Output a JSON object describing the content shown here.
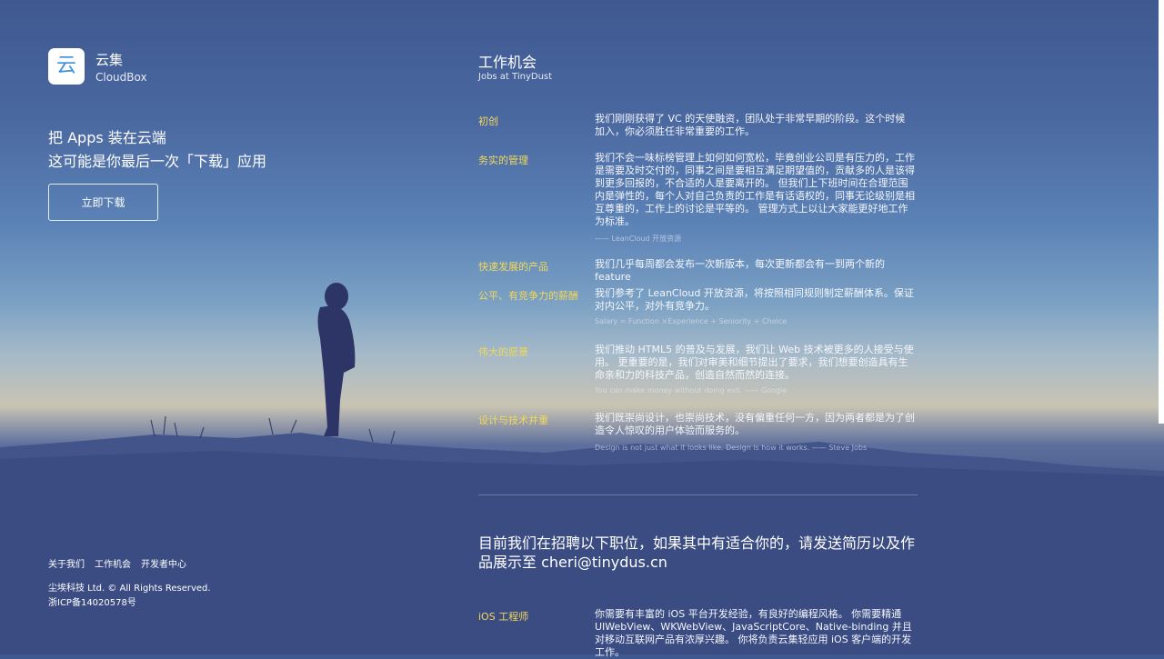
{
  "brand": {
    "logo_char": "云",
    "name_cn": "云集",
    "name_en": "CloudBox"
  },
  "hero": {
    "line1": "把 Apps 装在云端",
    "line2": "这可能是你最后一次「下载」应用",
    "download_button": "立即下载"
  },
  "footer": {
    "links": [
      "关于我们",
      "工作机会",
      "开发者中心"
    ],
    "copyright": "尘埃科技 Ltd. © All Rights Reserved.",
    "icp": "浙ICP备14020578号"
  },
  "jobs": {
    "title": "工作机会",
    "subtitle": "Jobs at TinyDust",
    "items": [
      {
        "label": "初创",
        "text": "我们刚刚获得了 VC 的天使融资，团队处于非常早期的阶段。这个时候加入，你必须胜任非常重要的工作。",
        "note": ""
      },
      {
        "label": "务实的管理",
        "text": "我们不会一味标榜管理上如何如何宽松，毕竟创业公司是有压力的，工作是需要及时交付的，同事之间是要相互满足期望值的，贡献多的人是该得到更多回报的，不合适的人是要离开的。 但我们上下班时间在合理范围内是弹性的，每个人对自己负责的工作是有话语权的，同事无论级别是相互尊重的，工作上的讨论是平等的。 管理方式上以让大家能更好地工作为标准。",
        "note": "—— LeanCloud 开放资源"
      },
      {
        "label": "快速发展的产品",
        "text": "我们几乎每周都会发布一次新版本，每次更新都会有一到两个新的 feature",
        "note": ""
      },
      {
        "label": "公平、有竞争力的薪酬",
        "text": "我们参考了 LeanCloud 开放资源，将按照相同规则制定薪酬体系。保证对内公平，对外有竞争力。",
        "note": "Salary = Function ×Experience + Seniority + Choice"
      },
      {
        "label": "伟大的愿景",
        "text": "我们推动 HTML5 的普及与发展，我们让 Web 技术被更多的人接受与使用。 更重要的是，我们对审美和细节提出了要求，我们想要创造具有生命亲和力的科技产品，创造自然而然的连接。",
        "note": "You can make money without doing evil. —— Google"
      },
      {
        "label": "设计与技术并重",
        "text": "我们既崇尚设计，也崇尚技术，没有偏重任何一方，因为两者都是为了创造令人惊叹的用户体验而服务的。",
        "note": "Design is not just what it looks like. Design is how it works. —— Steve Jobs"
      }
    ],
    "recruit_text": "目前我们在招聘以下职位，如果其中有适合你的，请发送简历以及作品展示至 cheri@tinydus.cn",
    "positions": [
      {
        "label": "iOS 工程师",
        "text": "你需要有丰富的 iOS 平台开发经验，有良好的编程风格。 你需要精通 UIWebView、WKWebView、JavaScriptCore、Native-binding 并且对移动互联网产品有浓厚兴趣。 你将负责云集轻应用 iOS 客户端的开发工作。"
      }
    ]
  },
  "colors": {
    "accent_yellow": "#f2d85a",
    "logo_blue": "#3d8fe0"
  }
}
